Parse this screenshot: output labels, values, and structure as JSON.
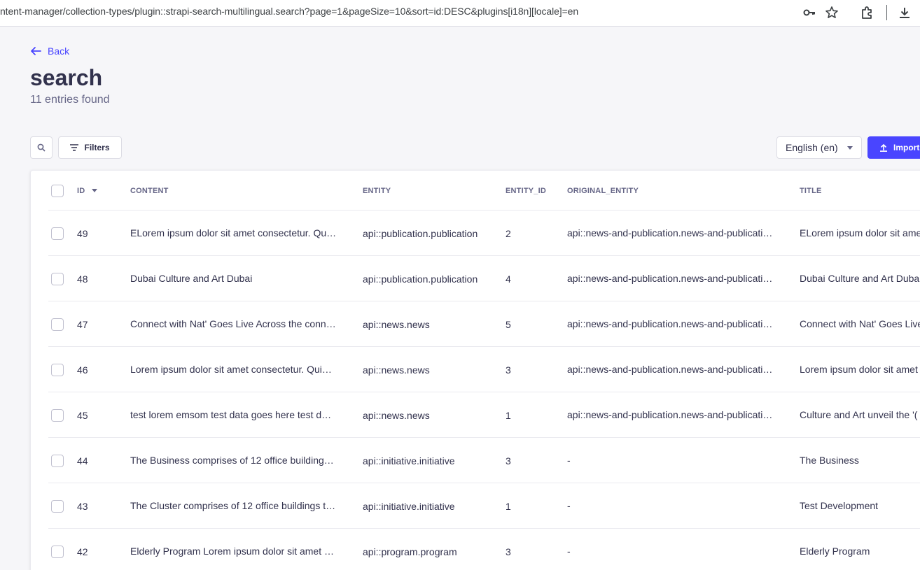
{
  "browser": {
    "url": "ntent-manager/collection-types/plugin::strapi-search-multilingual.search?page=1&pageSize=10&sort=id:DESC&plugins[i18n][locale]=en"
  },
  "header": {
    "back_label": "Back",
    "title": "search",
    "subtitle": "11 entries found"
  },
  "actions": {
    "filters_label": "Filters",
    "locale_value": "English (en)",
    "import_label": "Import"
  },
  "colors": {
    "accent": "#4945ff",
    "text": "#32324d",
    "muted": "#666687",
    "background": "#f6f6f9"
  },
  "table": {
    "columns": [
      "ID",
      "CONTENT",
      "ENTITY",
      "ENTITY_ID",
      "ORIGINAL_ENTITY",
      "TITLE"
    ],
    "rows": [
      {
        "id": "49",
        "content": "ELorem ipsum dolor sit amet consectetur. Qu…",
        "entity": "api::publication.publication",
        "entity_id": "2",
        "original_entity": "api::news-and-publication.news-and-publicati…",
        "title": "ELorem ipsum dolor sit amet"
      },
      {
        "id": "48",
        "content": "Dubai Culture and Art Dubai",
        "entity": "api::publication.publication",
        "entity_id": "4",
        "original_entity": "api::news-and-publication.news-and-publicati…",
        "title": "Dubai Culture and Art Dubai"
      },
      {
        "id": "47",
        "content": "Connect with Nat' Goes Live Across the conn…",
        "entity": "api::news.news",
        "entity_id": "5",
        "original_entity": "api::news-and-publication.news-and-publicati…",
        "title": "Connect with Nat' Goes Live"
      },
      {
        "id": "46",
        "content": "Lorem ipsum dolor sit amet consectetur. Qui…",
        "entity": "api::news.news",
        "entity_id": "3",
        "original_entity": "api::news-and-publication.news-and-publicati…",
        "title": "Lorem ipsum dolor sit amet"
      },
      {
        "id": "45",
        "content": "test lorem emsom test data goes here test d…",
        "entity": "api::news.news",
        "entity_id": "1",
        "original_entity": "api::news-and-publication.news-and-publicati…",
        "title": "Culture and Art unveil the '("
      },
      {
        "id": "44",
        "content": "The Business comprises of 12 office building…",
        "entity": "api::initiative.initiative",
        "entity_id": "3",
        "original_entity": "-",
        "title": "The Business"
      },
      {
        "id": "43",
        "content": "The Cluster comprises of 12 office buildings t…",
        "entity": "api::initiative.initiative",
        "entity_id": "1",
        "original_entity": "-",
        "title": "Test Development"
      },
      {
        "id": "42",
        "content": "Elderly Program Lorem ipsum dolor sit amet …",
        "entity": "api::program.program",
        "entity_id": "3",
        "original_entity": "-",
        "title": "Elderly Program"
      }
    ]
  }
}
